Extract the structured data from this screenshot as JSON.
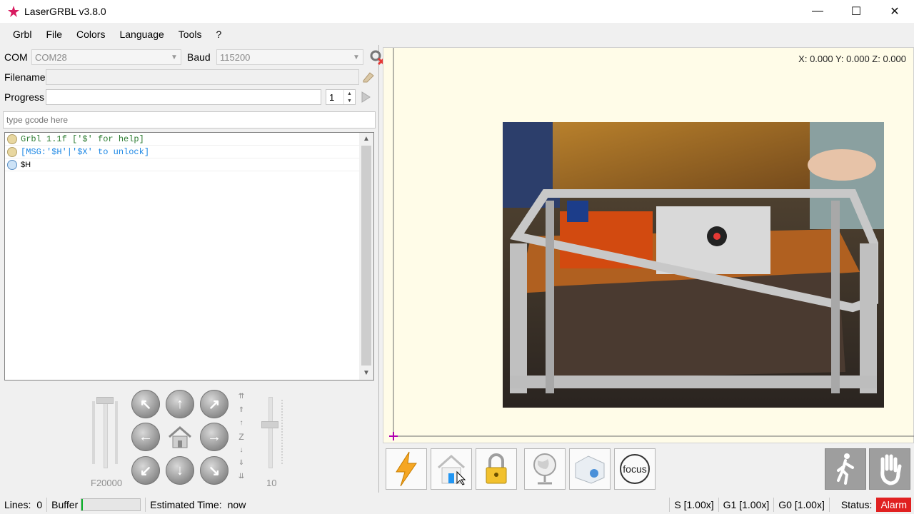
{
  "window": {
    "title": "LaserGRBL v3.8.0",
    "controls": {
      "minimize": "—",
      "maximize": "☐",
      "close": "✕"
    }
  },
  "menu": [
    "Grbl",
    "File",
    "Colors",
    "Language",
    "Tools",
    "?"
  ],
  "connection": {
    "com_label": "COM",
    "com_value": "COM28",
    "baud_label": "Baud",
    "baud_value": "115200"
  },
  "file": {
    "filename_label": "Filename",
    "filename_value": "",
    "progress_label": "Progress",
    "progress_value": "",
    "copies_value": "1"
  },
  "gcode_input": {
    "placeholder": "type gcode here"
  },
  "console": [
    {
      "text": "Grbl 1.1f ['$' for help]",
      "color": "#2e7d32",
      "icon": "info-icon"
    },
    {
      "text": "[MSG:'$H'|'$X' to unlock]",
      "color": "#1e88e5",
      "icon": "info-icon"
    },
    {
      "text": "$H",
      "color": "#000000",
      "icon": "command-icon"
    }
  ],
  "jog": {
    "speed_label": "F20000",
    "step_label": "10",
    "z_label": "Z"
  },
  "preview": {
    "coords": "X: 0.000 Y: 0.000 Z: 0.000"
  },
  "toolbar": {
    "focus_label": "focus"
  },
  "status": {
    "lines_label": "Lines:",
    "lines_value": "0",
    "buffer_label": "Buffer",
    "buffer_fill": 0.02,
    "est_label": "Estimated Time:",
    "est_value": "now",
    "s_override": "S [1.00x]",
    "g1_override": "G1 [1.00x]",
    "g0_override": "G0 [1.00x]",
    "status_label": "Status:",
    "status_value": "Alarm",
    "status_color": "#e02020",
    "buffer_color": "#06b025"
  }
}
